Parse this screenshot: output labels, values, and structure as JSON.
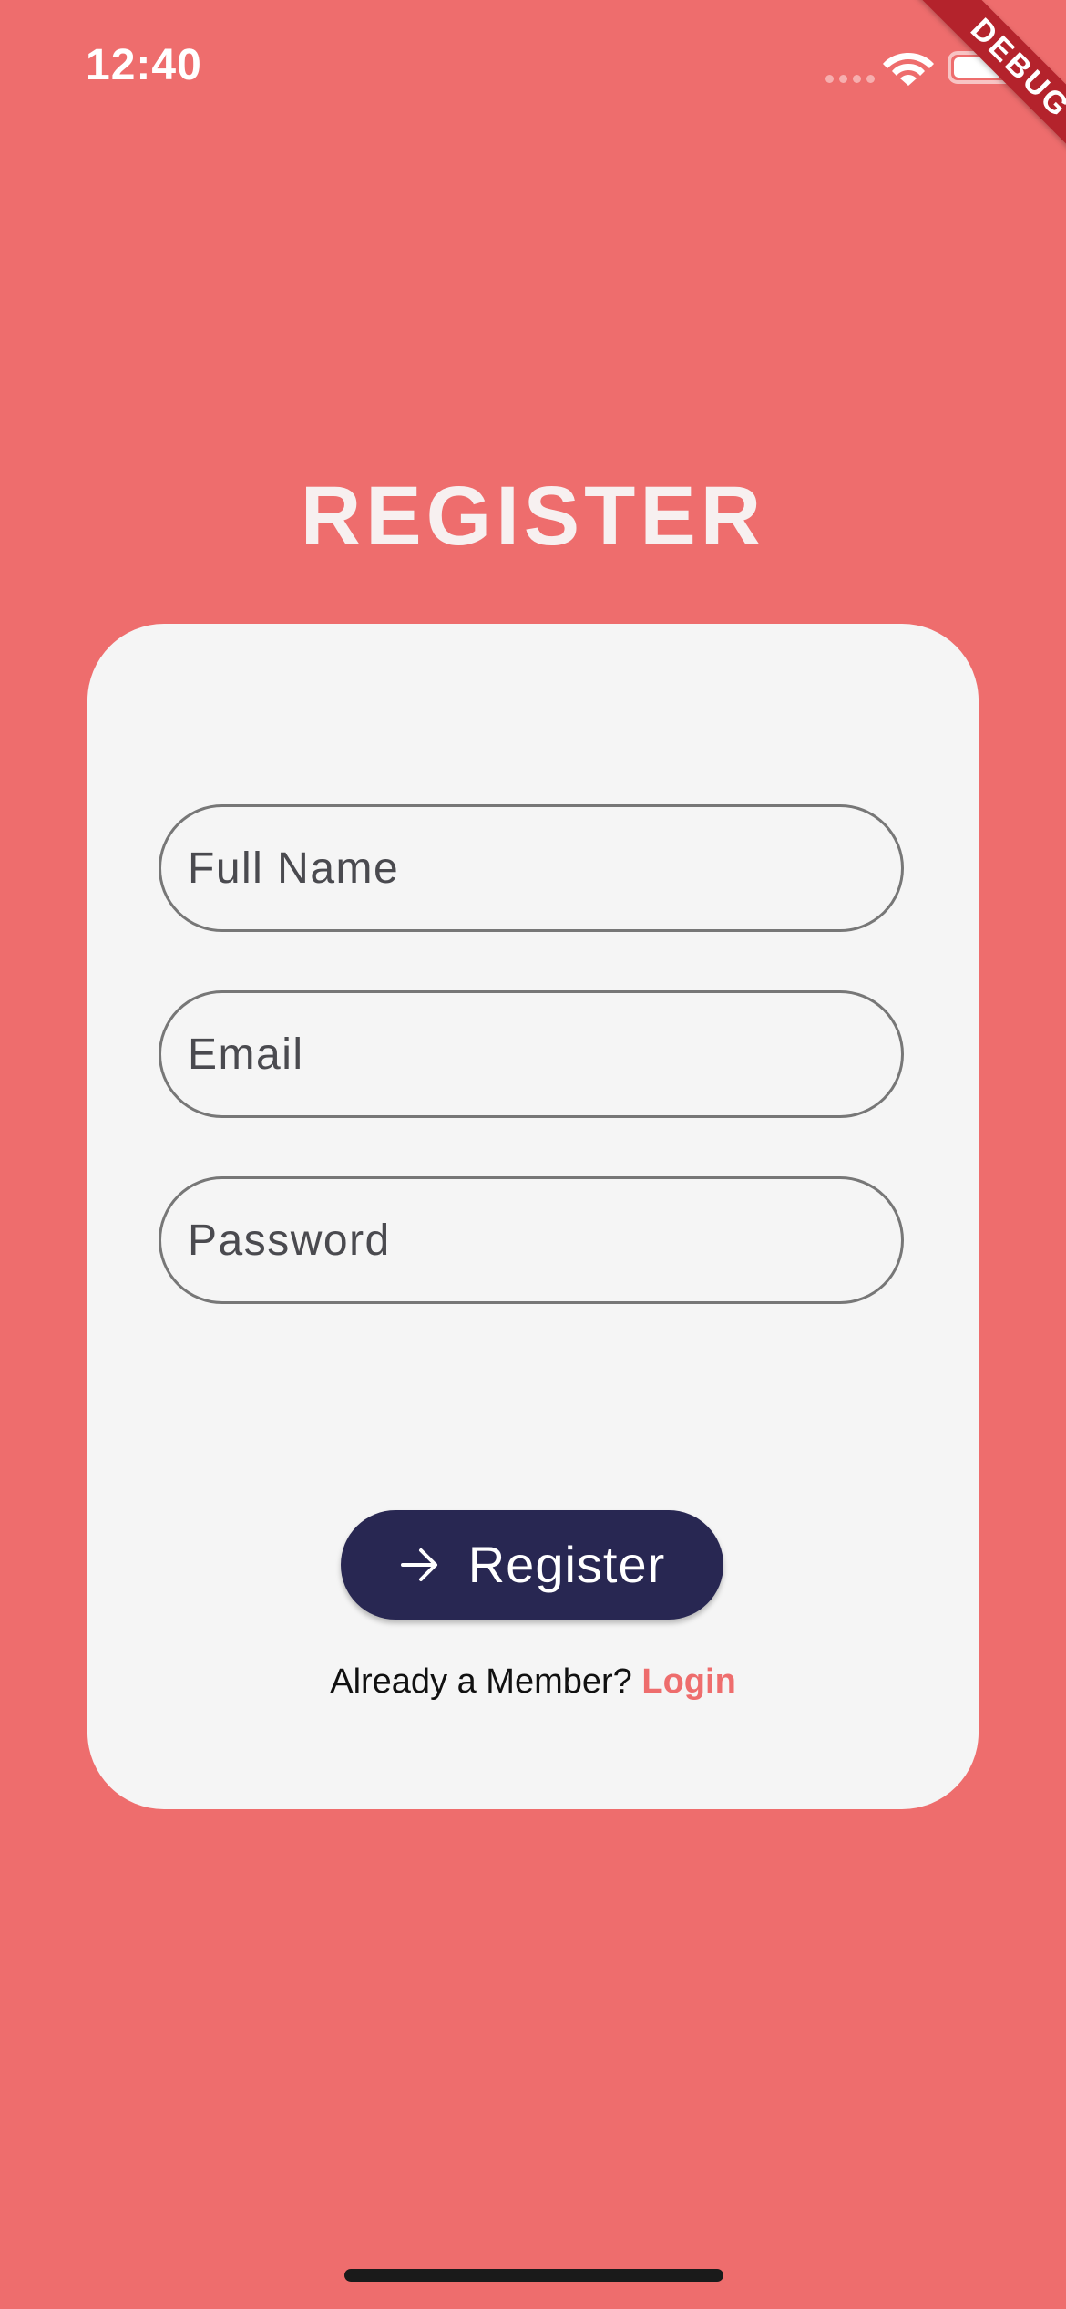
{
  "status_bar": {
    "time": "12:40"
  },
  "debug_banner": {
    "label": "DEBUG"
  },
  "page": {
    "title": "REGISTER"
  },
  "form": {
    "full_name": {
      "placeholder": "Full Name",
      "value": ""
    },
    "email": {
      "placeholder": "Email",
      "value": ""
    },
    "password": {
      "placeholder": "Password",
      "value": ""
    },
    "submit": {
      "label": "Register",
      "icon": "arrow-right-icon"
    },
    "footer": {
      "prompt": "Already a Member? ",
      "link_label": "Login"
    }
  },
  "colors": {
    "background": "#ee6d6d",
    "card": "#f5f5f5",
    "button": "#282752",
    "link": "#ee6d6d",
    "field_border": "#777777"
  },
  "icons": {
    "wifi": "wifi-icon",
    "battery": "battery-icon",
    "signal": "cellular-signal-icon"
  }
}
